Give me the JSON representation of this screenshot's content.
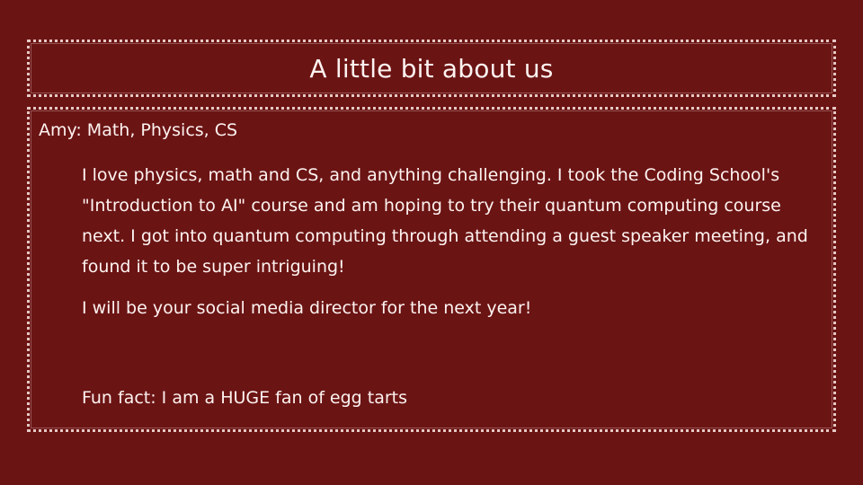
{
  "slide": {
    "title": "A little bit about us",
    "heading": "Amy: Math, Physics, CS",
    "paragraphs": [
      "I love physics, math and CS, and anything challenging. I took the Coding School's \"Introduction to AI\" course and am hoping to try their quantum computing course next. I got into quantum computing through attending a guest speaker meeting, and found it to be super intriguing!",
      "I will be your social media director for the next year!",
      "Fun fact: I am a HUGE fan of egg tarts"
    ]
  },
  "colors": {
    "background": "#6b1414",
    "text": "#fdf3f0",
    "border": "#e6c9c4"
  }
}
